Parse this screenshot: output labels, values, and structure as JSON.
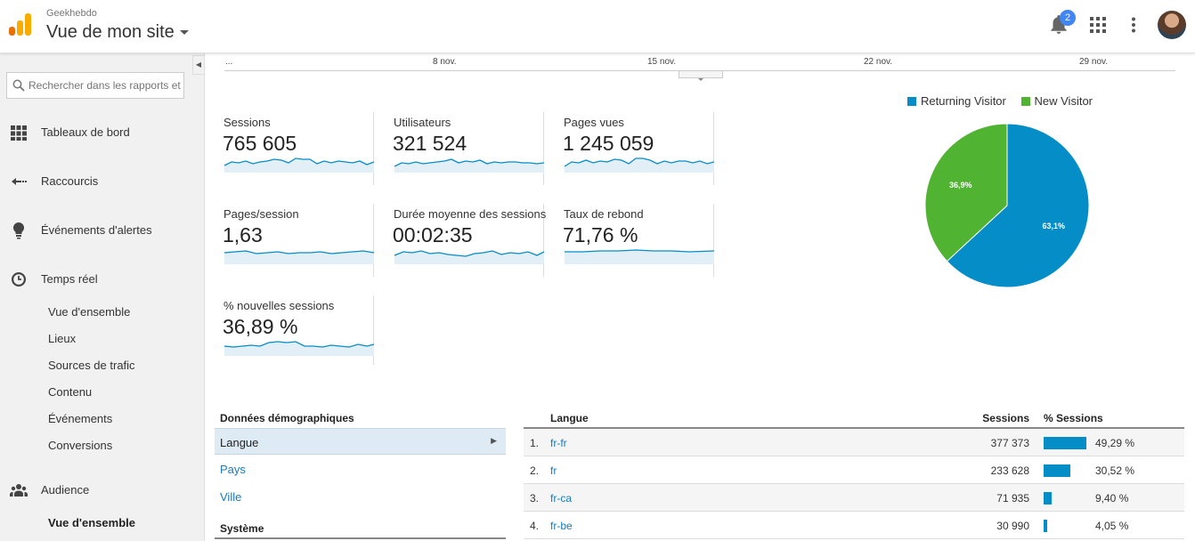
{
  "header": {
    "account": "Geekhebdo",
    "site_title": "Vue de mon site",
    "notification_count": "2",
    "icons": [
      "analytics-logo-icon",
      "bell-icon",
      "apps-grid-icon",
      "more-vert-icon",
      "avatar"
    ]
  },
  "sidebar": {
    "search_placeholder": "Rechercher dans les rapports et l'aide",
    "items": [
      {
        "label": "Tableaux de bord",
        "icon": "dashboard-grid-icon"
      },
      {
        "label": "Raccourcis",
        "icon": "shortcut-arrow-icon"
      },
      {
        "label": "Événements d'alertes",
        "icon": "lightbulb-icon"
      },
      {
        "label": "Temps réel",
        "icon": "clock-icon"
      },
      {
        "label": "Audience",
        "icon": "people-icon"
      }
    ],
    "realtime_sub": [
      "Vue d'ensemble",
      "Lieux",
      "Sources de trafic",
      "Contenu",
      "Événements",
      "Conversions"
    ],
    "audience_sub": [
      "Vue d'ensemble"
    ]
  },
  "timeline": {
    "labels": [
      "...",
      "8 nov.",
      "15 nov.",
      "22 nov.",
      "29 nov."
    ]
  },
  "metrics": [
    {
      "name": "Sessions",
      "value": "765 605"
    },
    {
      "name": "Utilisateurs",
      "value": "321 524"
    },
    {
      "name": "Pages vues",
      "value": "1 245 059"
    },
    {
      "name": "Pages/session",
      "value": "1,63"
    },
    {
      "name": "Durée moyenne des sessions",
      "value": "00:02:35"
    },
    {
      "name": "Taux de rebond",
      "value": "71,76 %"
    },
    {
      "name": "% nouvelles sessions",
      "value": "36,89 %"
    }
  ],
  "chart_data": {
    "type": "pie",
    "labels": [
      "Returning Visitor",
      "New Visitor"
    ],
    "values": [
      63.1,
      36.9
    ],
    "value_labels": [
      "63,1%",
      "36,9%"
    ],
    "colors": [
      "#058dc7",
      "#50b432"
    ],
    "legend": "top"
  },
  "demographics": {
    "heading": "Données démographiques",
    "items": [
      "Langue",
      "Pays",
      "Ville"
    ],
    "system_heading": "Système"
  },
  "language_table": {
    "headers": {
      "lang": "Langue",
      "sessions": "Sessions",
      "pct": "% Sessions"
    },
    "rows": [
      {
        "n": "1.",
        "lang": "fr-fr",
        "sessions": "377 373",
        "pct": "49,29 %",
        "pct_value": 49.29
      },
      {
        "n": "2.",
        "lang": "fr",
        "sessions": "233 628",
        "pct": "30,52 %",
        "pct_value": 30.52
      },
      {
        "n": "3.",
        "lang": "fr-ca",
        "sessions": "71 935",
        "pct": "9,40 %",
        "pct_value": 9.4
      },
      {
        "n": "4.",
        "lang": "fr-be",
        "sessions": "30 990",
        "pct": "4,05 %",
        "pct_value": 4.05
      }
    ]
  }
}
